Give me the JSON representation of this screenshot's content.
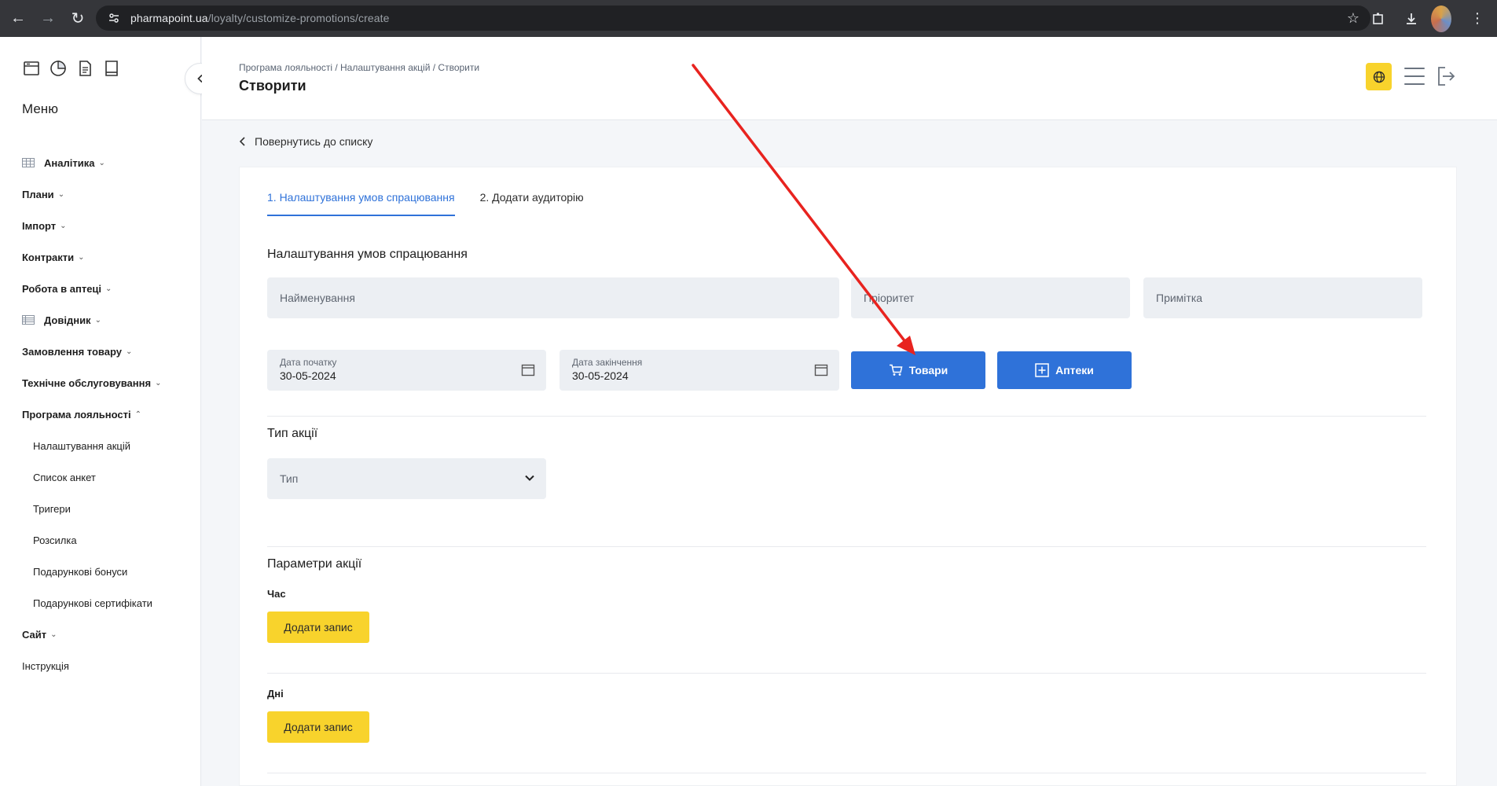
{
  "browser": {
    "url_host": "pharmapoint.ua",
    "url_path": "/loyalty/customize-promotions/create"
  },
  "sidebar": {
    "title": "Меню",
    "items": [
      {
        "label": "Аналітика",
        "icon": "table-icon",
        "chevron": "down"
      },
      {
        "label": "Плани",
        "chevron": "down"
      },
      {
        "label": "Імпорт",
        "chevron": "down"
      },
      {
        "label": "Контракти",
        "chevron": "down"
      },
      {
        "label": "Робота в аптеці",
        "chevron": "down"
      },
      {
        "label": "Довідник",
        "icon": "list-icon",
        "chevron": "down"
      },
      {
        "label": "Замовлення товару",
        "chevron": "down"
      },
      {
        "label": "Технічне обслуговування",
        "chevron": "down"
      },
      {
        "label": "Програма лояльності",
        "chevron": "up"
      }
    ],
    "subitems": [
      "Налаштування акцій",
      "Список анкет",
      "Тригери",
      "Розсилка",
      "Подарункові бонуси",
      "Подарункові сертифікати"
    ],
    "after": [
      {
        "label": "Сайт",
        "chevron": "down"
      }
    ],
    "plain": "Інструкція"
  },
  "header": {
    "breadcrumb": "Програма лояльності / Налаштування акцій / Створити",
    "title": "Створити"
  },
  "content": {
    "back_link": "Повернутись до списку",
    "tabs": [
      "1. Налаштування умов спрацювання",
      "2. Додати аудиторію"
    ],
    "conditions_title": "Налаштування умов спрацювання",
    "name_placeholder": "Найменування",
    "priority_placeholder": "Пріоритет",
    "note_placeholder": "Примітка",
    "start_date_label": "Дата початку",
    "start_date_value": "30-05-2024",
    "end_date_label": "Дата закінчення",
    "end_date_value": "30-05-2024",
    "goods_button": "Товари",
    "pharmacies_button": "Аптеки",
    "promo_type_title": "Тип акції",
    "type_select": "Тип",
    "params_title": "Параметри акції",
    "time_label": "Час",
    "add_record_1": "Додати запис",
    "days_label": "Дні",
    "add_record_2": "Додати запис"
  },
  "colors": {
    "accent_blue": "#2f72d9",
    "accent_yellow": "#f8d32c",
    "annotation_red": "#e8231f"
  }
}
